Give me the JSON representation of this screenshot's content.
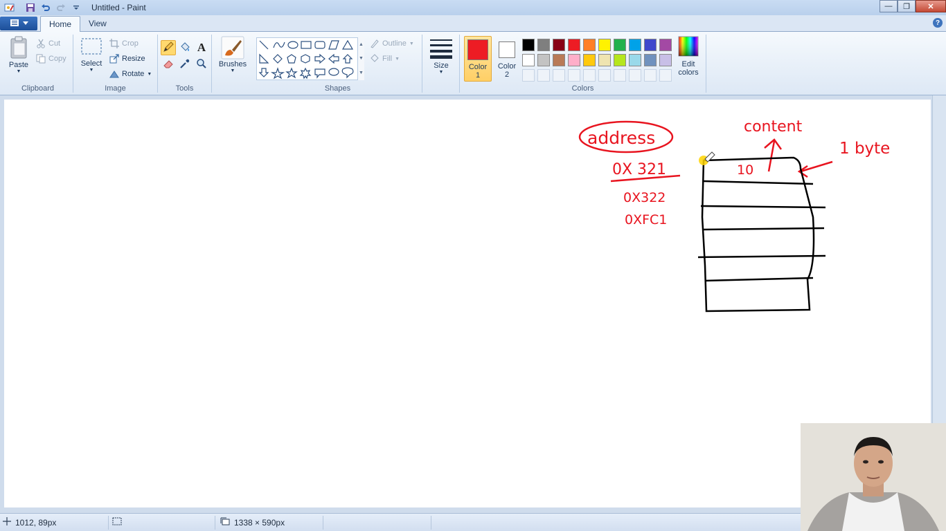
{
  "window": {
    "title": "Untitled - Paint",
    "minimize_glyph": "—",
    "maximize_glyph": "❐",
    "close_glyph": "✕"
  },
  "tabs": {
    "home": "Home",
    "view": "View"
  },
  "help_glyph": "?",
  "ribbon": {
    "clipboard": {
      "label": "Clipboard",
      "paste": "Paste",
      "cut": "Cut",
      "copy": "Copy"
    },
    "image": {
      "label": "Image",
      "select": "Select",
      "crop": "Crop",
      "resize": "Resize",
      "rotate": "Rotate"
    },
    "tools": {
      "label": "Tools",
      "text_glyph": "A"
    },
    "brushes": {
      "label": "Brushes"
    },
    "shapes": {
      "label": "Shapes",
      "outline": "Outline",
      "fill": "Fill"
    },
    "size": {
      "label": "Size"
    },
    "colors": {
      "label": "Colors",
      "color1_label": "Color",
      "color1_num": "1",
      "color2_label": "Color",
      "color2_num": "2",
      "edit_label": "Edit",
      "edit_label2": "colors",
      "color1_value": "#ed1c24",
      "color2_value": "#ffffff",
      "palette_row1": [
        "#000000",
        "#7f7f7f",
        "#880015",
        "#ed1c24",
        "#ff7f27",
        "#fff200",
        "#22b14c",
        "#00a2e8",
        "#3f48cc",
        "#a349a4"
      ],
      "palette_row2": [
        "#ffffff",
        "#c3c3c3",
        "#b97a57",
        "#ffaec9",
        "#ffc90e",
        "#efe4b0",
        "#b5e61d",
        "#99d9ea",
        "#7092be",
        "#c8bfe7"
      ]
    }
  },
  "drawing": {
    "address": "address",
    "content": "content",
    "one_byte": "1 byte",
    "addr1": "0X 321",
    "addr2": "0X322",
    "addr3": "0XFC1",
    "cell_value": "10"
  },
  "status": {
    "cursor_pos": "1012, 89px",
    "canvas_size": "1338 × 590px"
  }
}
